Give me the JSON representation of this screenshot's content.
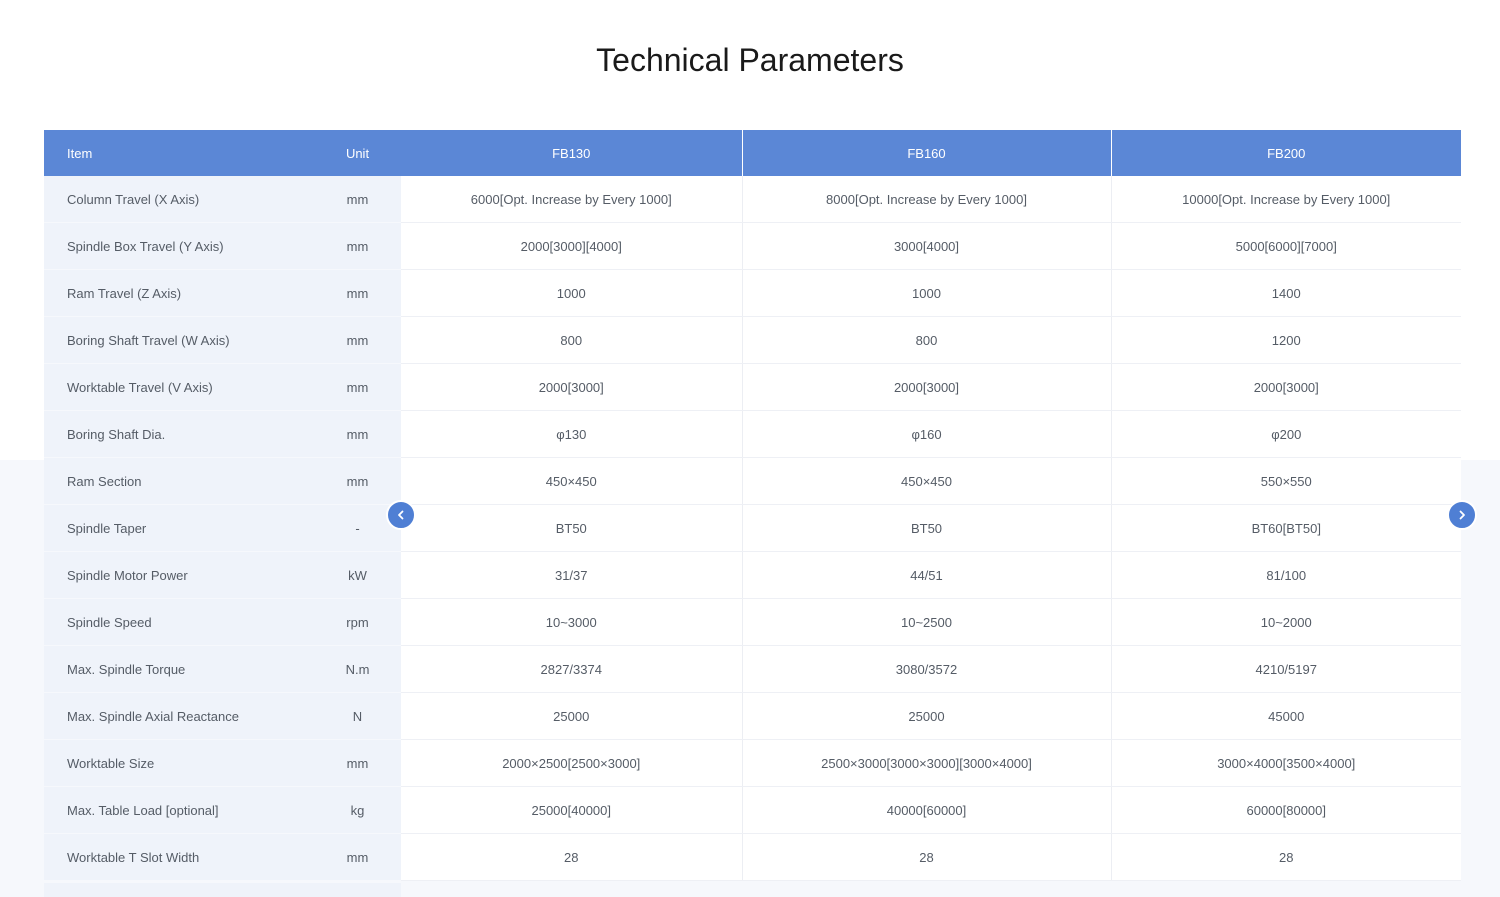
{
  "page": {
    "title": "Technical Parameters"
  },
  "colors": {
    "header_bg": "#5b87d6",
    "label_bg": "#eff3fa",
    "nav_button": "#4f7fd4"
  },
  "table": {
    "headers": {
      "item": "Item",
      "unit": "Unit",
      "models": [
        "FB130",
        "FB160",
        "FB200"
      ]
    },
    "rows": [
      {
        "item": "Column Travel (X Axis)",
        "unit": "mm",
        "values": [
          "6000[Opt. Increase by Every 1000]",
          "8000[Opt. Increase by Every 1000]",
          "10000[Opt. Increase by Every 1000]"
        ]
      },
      {
        "item": "Spindle Box Travel (Y Axis)",
        "unit": "mm",
        "values": [
          "2000[3000][4000]",
          "3000[4000]",
          "5000[6000][7000]"
        ]
      },
      {
        "item": "Ram Travel (Z Axis)",
        "unit": "mm",
        "values": [
          "1000",
          "1000",
          "1400"
        ]
      },
      {
        "item": "Boring Shaft Travel (W Axis)",
        "unit": "mm",
        "values": [
          "800",
          "800",
          "1200"
        ]
      },
      {
        "item": "Worktable Travel (V Axis)",
        "unit": "mm",
        "values": [
          "2000[3000]",
          "2000[3000]",
          "2000[3000]"
        ]
      },
      {
        "item": "Boring Shaft Dia.",
        "unit": "mm",
        "values": [
          "φ130",
          "φ160",
          "φ200"
        ]
      },
      {
        "item": "Ram Section",
        "unit": "mm",
        "values": [
          "450×450",
          "450×450",
          "550×550"
        ]
      },
      {
        "item": "Spindle Taper",
        "unit": "-",
        "values": [
          "BT50",
          "BT50",
          "BT60[BT50]"
        ]
      },
      {
        "item": "Spindle Motor Power",
        "unit": "kW",
        "values": [
          "31/37",
          "44/51",
          "81/100"
        ]
      },
      {
        "item": "Spindle Speed",
        "unit": "rpm",
        "values": [
          "10~3000",
          "10~2500",
          "10~2000"
        ]
      },
      {
        "item": "Max. Spindle Torque",
        "unit": "N.m",
        "values": [
          "2827/3374",
          "3080/3572",
          "4210/5197"
        ]
      },
      {
        "item": "Max. Spindle Axial Reactance",
        "unit": "N",
        "values": [
          "25000",
          "25000",
          "45000"
        ]
      },
      {
        "item": "Worktable Size",
        "unit": "mm",
        "values": [
          "2000×2500[2500×3000]",
          "2500×3000[3000×3000][3000×4000]",
          "3000×4000[3500×4000]"
        ]
      },
      {
        "item": "Max. Table Load [optional]",
        "unit": "kg",
        "values": [
          "25000[40000]",
          "40000[60000]",
          "60000[80000]"
        ]
      },
      {
        "item": "Worktable T Slot Width",
        "unit": "mm",
        "values": [
          "28",
          "28",
          "28"
        ]
      }
    ]
  },
  "nav": {
    "prev_icon": "chevron-left-icon",
    "next_icon": "chevron-right-icon"
  }
}
